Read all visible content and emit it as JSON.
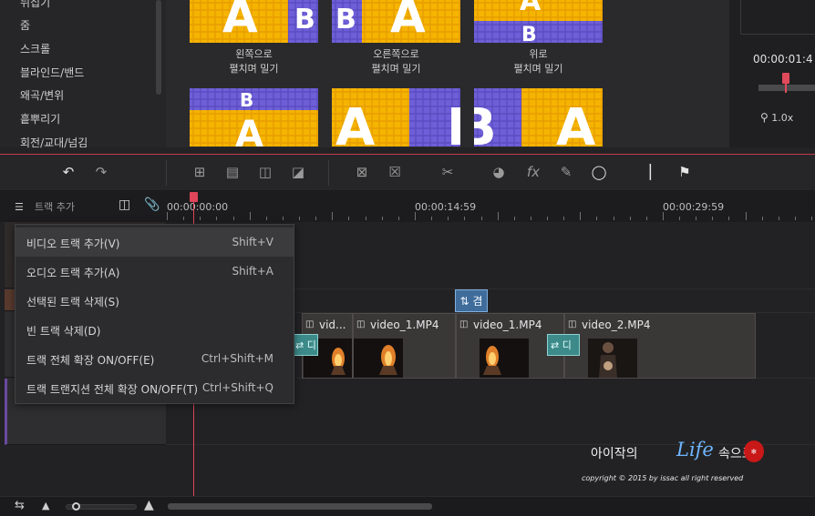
{
  "library": {
    "categories": [
      "뒤집기",
      "줌",
      "스크롤",
      "블라인드/밴드",
      "왜곡/변위",
      "흩뿌리기",
      "회전/교대/넘김"
    ],
    "transitions_row1": [
      {
        "label": "왼쪽으로\n펼치며 밀기"
      },
      {
        "label": "오른쪽으로\n펼치며 밀기"
      },
      {
        "label": "위로\n펼치며 밀기"
      }
    ],
    "letters": {
      "a": "A",
      "b": "B"
    }
  },
  "preview": {
    "timecode": "00:00:01:4",
    "zoom": "1.0x"
  },
  "timeline": {
    "add_track_label": "트랙 추가",
    "ruler": [
      "00:00:00:00",
      "00:00:14:59",
      "00:00:29:59"
    ],
    "transition_top_label": "겸",
    "clips": [
      {
        "name": "vid..."
      },
      {
        "name": "video_1.MP4"
      },
      {
        "name": "video_1.MP4"
      },
      {
        "name": "video_2.MP4"
      }
    ],
    "transition_clip_label": "디"
  },
  "context_menu": {
    "items": [
      {
        "label": "비디오 트랙 추가(V)",
        "shortcut": "Shift+V"
      },
      {
        "label": "오디오 트랙 추가(A)",
        "shortcut": "Shift+A"
      },
      {
        "label": "선택된 트랙 삭제(S)",
        "shortcut": ""
      },
      {
        "label": "빈 트랙 삭제(D)",
        "shortcut": ""
      },
      {
        "label": "트랙 전체 확장 ON/OFF(E)",
        "shortcut": "Ctrl+Shift+M"
      },
      {
        "label": "트랙 트랜지션 전체 확장 ON/OFF(T)",
        "shortcut": "Ctrl+Shift+Q"
      }
    ]
  },
  "watermark": {
    "title_a": "아이작의",
    "title_life": "Life",
    "title_b": "속으로",
    "copyright": "copyright © 2015 by issac all right reserved"
  },
  "colors": {
    "accent": "#e0455a",
    "transition_teal": "#3c8a8a",
    "transition_blue": "#3f6c9a",
    "thumb_yellow": "#f5b400",
    "thumb_purple": "#6e5fd8"
  },
  "icons": [
    "undo-icon",
    "redo-icon",
    "scissors-icon",
    "speed-icon",
    "fx-icon",
    "pen-icon",
    "shield-icon",
    "marker-in-icon",
    "marker-out-icon",
    "add-track-icon",
    "search-icon"
  ]
}
